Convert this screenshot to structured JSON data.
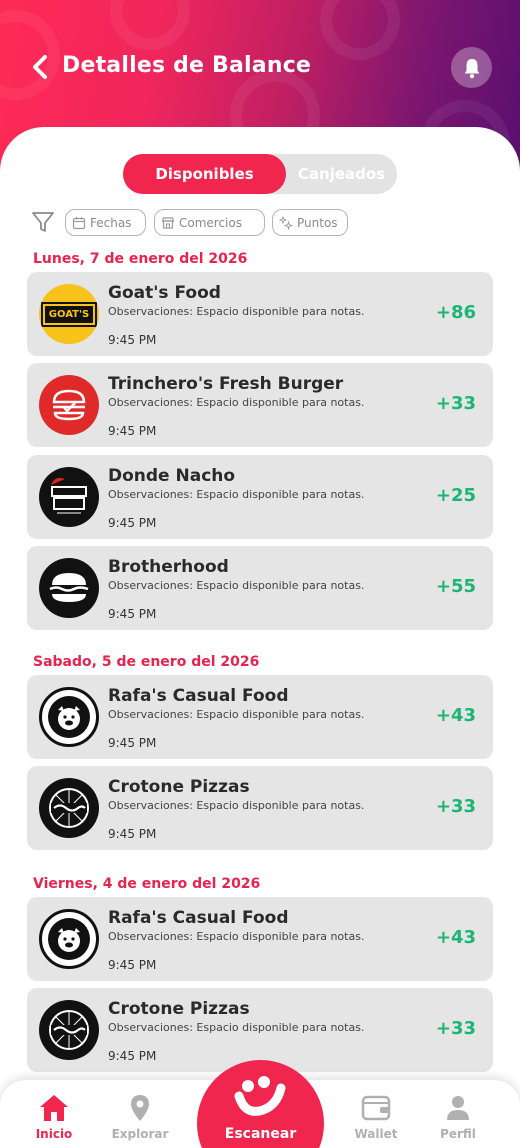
{
  "header": {
    "title": "Detalles de Balance"
  },
  "segmented": {
    "active": "Disponibles",
    "inactive": "Canjeados"
  },
  "filters": [
    "Fechas",
    "Comercios",
    "Puntos"
  ],
  "groups": [
    {
      "date": "Lunes, 7 de enero del 2026",
      "items": [
        {
          "name": "Goat's Food",
          "obs": "Observaciones: Espacio disponible para notas.",
          "time": "9:45 PM",
          "points": "+86",
          "logo_text": "GOAT'S"
        },
        {
          "name": "Trinchero's Fresh Burger",
          "obs": "Observaciones: Espacio disponible para notas.",
          "time": "9:45 PM",
          "points": "+33"
        },
        {
          "name": "Donde Nacho",
          "obs": "Observaciones: Espacio disponible para notas.",
          "time": "9:45 PM",
          "points": "+25"
        },
        {
          "name": "Brotherhood",
          "obs": "Observaciones: Espacio disponible para notas.",
          "time": "9:45 PM",
          "points": "+55"
        }
      ]
    },
    {
      "date": "Sabado, 5 de enero del 2026",
      "items": [
        {
          "name": "Rafa's Casual Food",
          "obs": "Observaciones: Espacio disponible para notas.",
          "time": "9:45 PM",
          "points": "+43"
        },
        {
          "name": "Crotone Pizzas",
          "obs": "Observaciones: Espacio disponible para notas.",
          "time": "9:45 PM",
          "points": "+33"
        }
      ]
    },
    {
      "date": "Viernes, 4 de enero del 2026",
      "items": [
        {
          "name": "Rafa's Casual Food",
          "obs": "Observaciones: Espacio disponible para notas.",
          "time": "9:45 PM",
          "points": "+43"
        },
        {
          "name": "Crotone Pizzas",
          "obs": "Observaciones: Espacio disponible para notas.",
          "time": "9:45 PM",
          "points": "+33"
        }
      ]
    }
  ],
  "nav": {
    "inicio": "Inicio",
    "explorar": "Explorar",
    "escanear": "Escanear",
    "wallet": "Wallet",
    "perfil": "Perfil"
  },
  "colors": {
    "primary": "#f0264e",
    "points": "#1bb673",
    "card_bg": "#e5e5e5"
  }
}
